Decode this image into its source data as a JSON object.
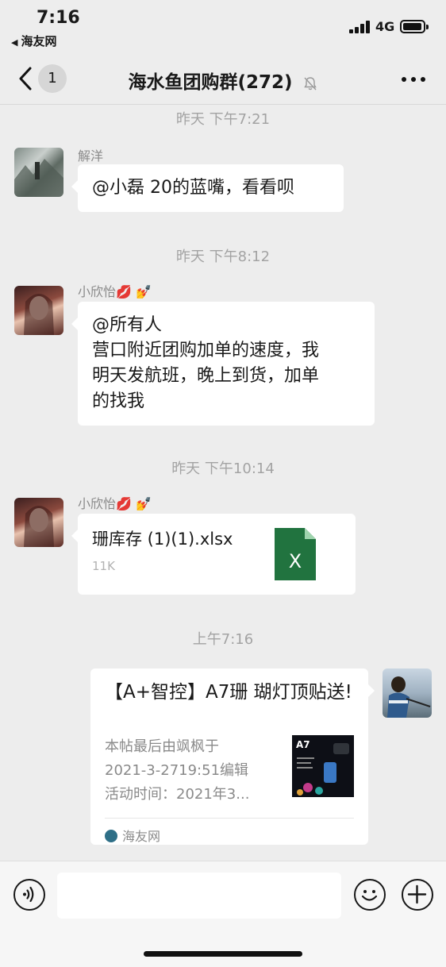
{
  "status": {
    "time": "7:16",
    "back_app": "海友网",
    "network": "4G"
  },
  "nav": {
    "unread_count": "1",
    "title": "海水鱼团购群(272)"
  },
  "messages": [
    {
      "timestamp": "昨天 下午7:21",
      "sender": "解洋",
      "text": "@小磊 20的蓝嘴，看看呗"
    },
    {
      "timestamp": "昨天 下午8:12",
      "sender": "小欣怡💋 💅",
      "lines": [
        "@所有人",
        "营口附近团购加单的速度，我",
        "明天发航班，晚上到货，加单",
        "的找我"
      ]
    },
    {
      "timestamp": "昨天 下午10:14",
      "sender": "小欣怡💋 💅",
      "file_name": "珊库存 (1)(1).xlsx",
      "file_size": "11K",
      "file_icon_letter": "X"
    },
    {
      "timestamp": "上午7:16",
      "link_title": "【A+智控】A7珊 瑚灯顶贴送!",
      "link_desc": [
        "本帖最后由飒枫于",
        "2021-3-2719:51编辑",
        "活动时间：2021年3..."
      ],
      "thumb_label": "A7",
      "source": "海友网"
    }
  ],
  "colors": {
    "bg": "#ededed",
    "bubble": "#ffffff",
    "excel_green": "#21733f"
  }
}
